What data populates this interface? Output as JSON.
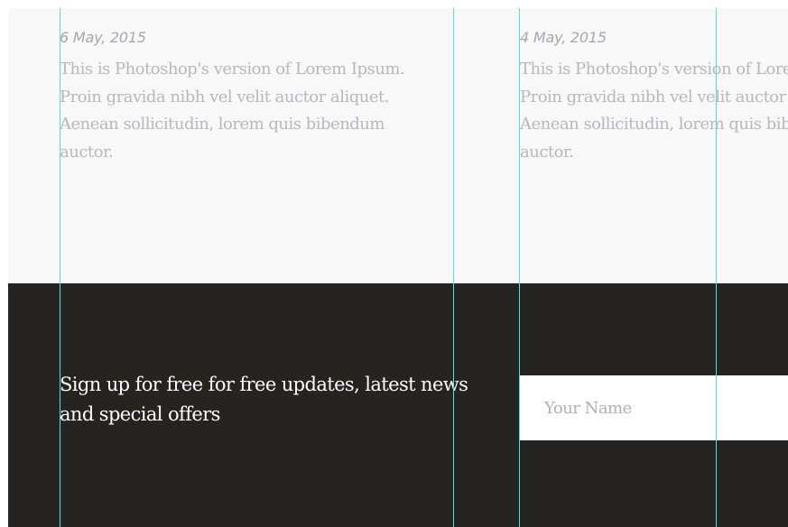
{
  "posts": [
    {
      "date": "6 May, 2015",
      "excerpt": "This is Photoshop's version  of Lorem Ipsum. Proin gravida nibh vel velit auctor aliquet. Aenean sollicitudin, lorem quis bibendum auctor."
    },
    {
      "date": "4 May, 2015",
      "excerpt": "This is Photoshop's version  of Lorem Ipsum. Proin gravida nibh vel velit auctor aliquet. Aenean sollicitudin, lorem quis bibendum auctor."
    }
  ],
  "newsletter": {
    "heading": "Sign up for free for free updates, latest news and special offers",
    "name_placeholder": "Your Name"
  },
  "colors": {
    "top_background": "#f8f8f9",
    "footer_background": "#262420",
    "guide": "#4de3e6"
  }
}
